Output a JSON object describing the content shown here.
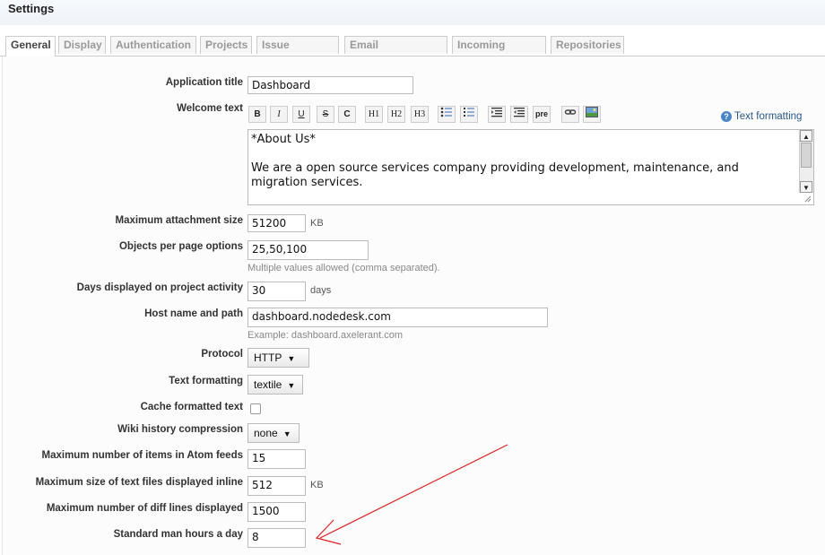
{
  "header": {
    "title": "Settings"
  },
  "tabs": [
    "General",
    "Display",
    "Authentication",
    "Projects",
    "Issue tracking",
    "Email notifications",
    "Incoming emails",
    "Repositories"
  ],
  "form": {
    "app_title": {
      "label": "Application title",
      "value": "Dashboard"
    },
    "welcome": {
      "label": "Welcome text",
      "help": "Text formatting",
      "toolbar": [
        "B",
        "I",
        "U",
        "S",
        "C",
        "H1",
        "H2",
        "H3",
        "ul",
        "ol",
        "indent",
        "outdent",
        "pre",
        "link",
        "image"
      ],
      "content": "*About Us*\n\nWe are a open source services company providing development, maintenance, and\nmigration services."
    },
    "max_attach": {
      "label": "Maximum attachment size",
      "value": "51200",
      "unit": "KB"
    },
    "per_page": {
      "label": "Objects per page options",
      "value": "25,50,100",
      "hint": "Multiple values allowed (comma separated)."
    },
    "days_activity": {
      "label": "Days displayed on project activity",
      "value": "30",
      "unit": "days"
    },
    "host": {
      "label": "Host name and path",
      "value": "dashboard.nodedesk.com",
      "hint": "Example: dashboard.axelerant.com"
    },
    "protocol": {
      "label": "Protocol",
      "value": "HTTP"
    },
    "text_format": {
      "label": "Text formatting",
      "value": "textile"
    },
    "cache": {
      "label": "Cache formatted text",
      "checked": false
    },
    "wiki_comp": {
      "label": "Wiki history compression",
      "value": "none"
    },
    "atom": {
      "label": "Maximum number of items in Atom feeds",
      "value": "15"
    },
    "text_inline": {
      "label": "Maximum size of text files displayed inline",
      "value": "512",
      "unit": "KB"
    },
    "diff_lines": {
      "label": "Maximum number of diff lines displayed",
      "value": "1500"
    },
    "man_hours": {
      "label": "Standard man hours a day",
      "value": "8"
    }
  },
  "colors": {
    "annotation_arrow": "#e02020",
    "help_link": "#2a5685"
  }
}
